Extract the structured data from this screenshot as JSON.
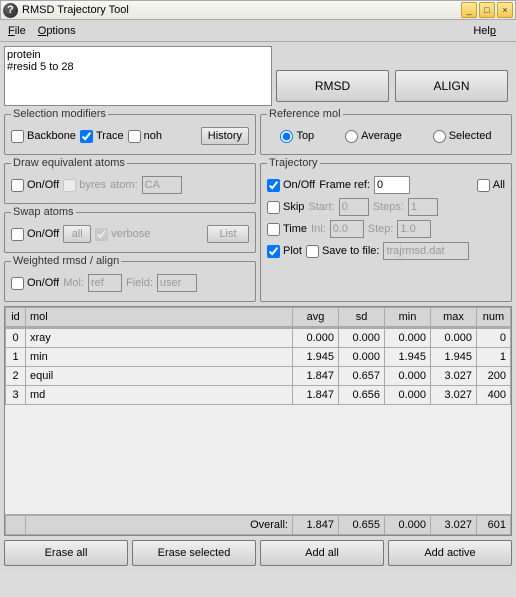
{
  "window": {
    "title": "RMSD Trajectory Tool"
  },
  "menu": {
    "file": "File",
    "options": "Options",
    "help": "Help"
  },
  "selection_text": "protein\n#resid 5 to 28",
  "buttons": {
    "rmsd": "RMSD",
    "align": "ALIGN"
  },
  "sel_mod": {
    "legend": "Selection modifiers",
    "backbone": "Backbone",
    "trace": "Trace",
    "noh": "noh",
    "history": "History"
  },
  "draw_eq": {
    "legend": "Draw equivalent atoms",
    "onoff": "On/Off",
    "byres": "byres",
    "atom_lbl": "atom:",
    "atom_val": "CA"
  },
  "swap": {
    "legend": "Swap atoms",
    "onoff": "On/Off",
    "all": "all",
    "verbose": "verbose",
    "list": "List"
  },
  "wrmsd": {
    "legend": "Weighted rmsd / align",
    "onoff": "On/Off",
    "mol_lbl": "Mol:",
    "mol_val": "ref",
    "field_lbl": "Field:",
    "field_val": "user"
  },
  "refmol": {
    "legend": "Reference mol",
    "top": "Top",
    "average": "Average",
    "selected": "Selected"
  },
  "traj": {
    "legend": "Trajectory",
    "onoff": "On/Off",
    "frame_ref": "Frame ref:",
    "frame_val": "0",
    "all": "All",
    "skip": "Skip",
    "start": "Start:",
    "start_val": "0",
    "steps": "Steps:",
    "steps_val": "1",
    "time": "Time",
    "ini": "Ini:",
    "ini_val": "0.0",
    "step": "Step:",
    "step_val": "1.0",
    "plot": "Plot",
    "save": "Save to file:",
    "save_val": "trajrmsd.dat"
  },
  "table": {
    "headers": {
      "id": "id",
      "mol": "mol",
      "avg": "avg",
      "sd": "sd",
      "min": "min",
      "max": "max",
      "num": "num"
    },
    "rows": [
      {
        "id": "0",
        "mol": "xray",
        "avg": "0.000",
        "sd": "0.000",
        "min": "0.000",
        "max": "0.000",
        "num": "0"
      },
      {
        "id": "1",
        "mol": "min",
        "avg": "1.945",
        "sd": "0.000",
        "min": "1.945",
        "max": "1.945",
        "num": "1"
      },
      {
        "id": "2",
        "mol": "equil",
        "avg": "1.847",
        "sd": "0.657",
        "min": "0.000",
        "max": "3.027",
        "num": "200"
      },
      {
        "id": "3",
        "mol": "md",
        "avg": "1.847",
        "sd": "0.656",
        "min": "0.000",
        "max": "3.027",
        "num": "400"
      }
    ],
    "overall": {
      "label": "Overall:",
      "avg": "1.847",
      "sd": "0.655",
      "min": "0.000",
      "max": "3.027",
      "num": "601"
    }
  },
  "bottom": {
    "erase_all": "Erase all",
    "erase_sel": "Erase selected",
    "add_all": "Add all",
    "add_active": "Add active"
  }
}
